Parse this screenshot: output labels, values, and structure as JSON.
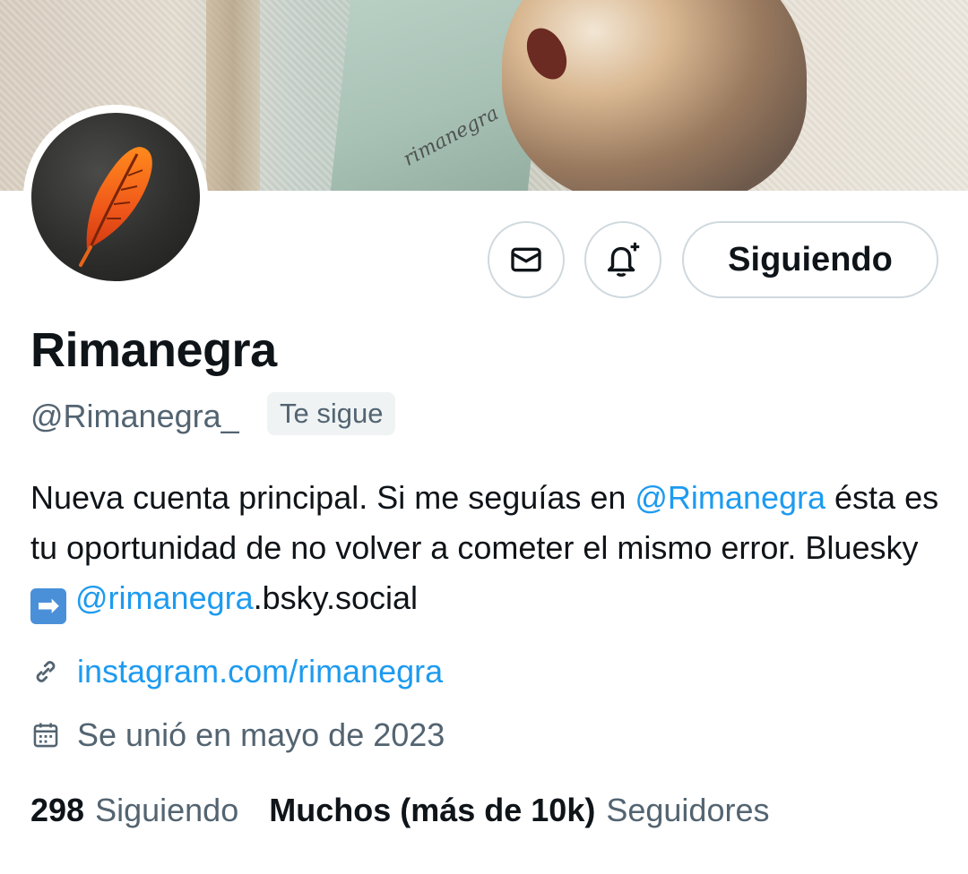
{
  "banner": {
    "watermark": "rimanegra"
  },
  "profile": {
    "name": "Rimanegra",
    "handle": "@Rimanegra_",
    "follows_you": "Te sigue"
  },
  "actions": {
    "message_icon": "envelope-icon",
    "notify_icon": "bell-plus-icon",
    "follow_label": "Siguiendo"
  },
  "bio": {
    "part1": "Nueva cuenta principal. Si me seguías en ",
    "mention1": "@Rimanegra",
    "part2": " ésta es tu oportunidad de no volver a cometer el mismo error. Bluesky ",
    "arrow": "➡",
    "mention2": "@rimanegra",
    "part3": ".bsky.social"
  },
  "meta": {
    "link_icon": "link-icon",
    "link": "instagram.com/rimanegra",
    "calendar_icon": "calendar-icon",
    "joined": "Se unió en mayo de 2023"
  },
  "stats": {
    "following_count": "298",
    "following_label": "Siguiendo",
    "followers_count": "Muchos (más de 10k)",
    "followers_label": "Seguidores"
  },
  "colors": {
    "accent": "#1d9bf0",
    "secondary_text": "#536471",
    "border": "#cfd9de"
  }
}
